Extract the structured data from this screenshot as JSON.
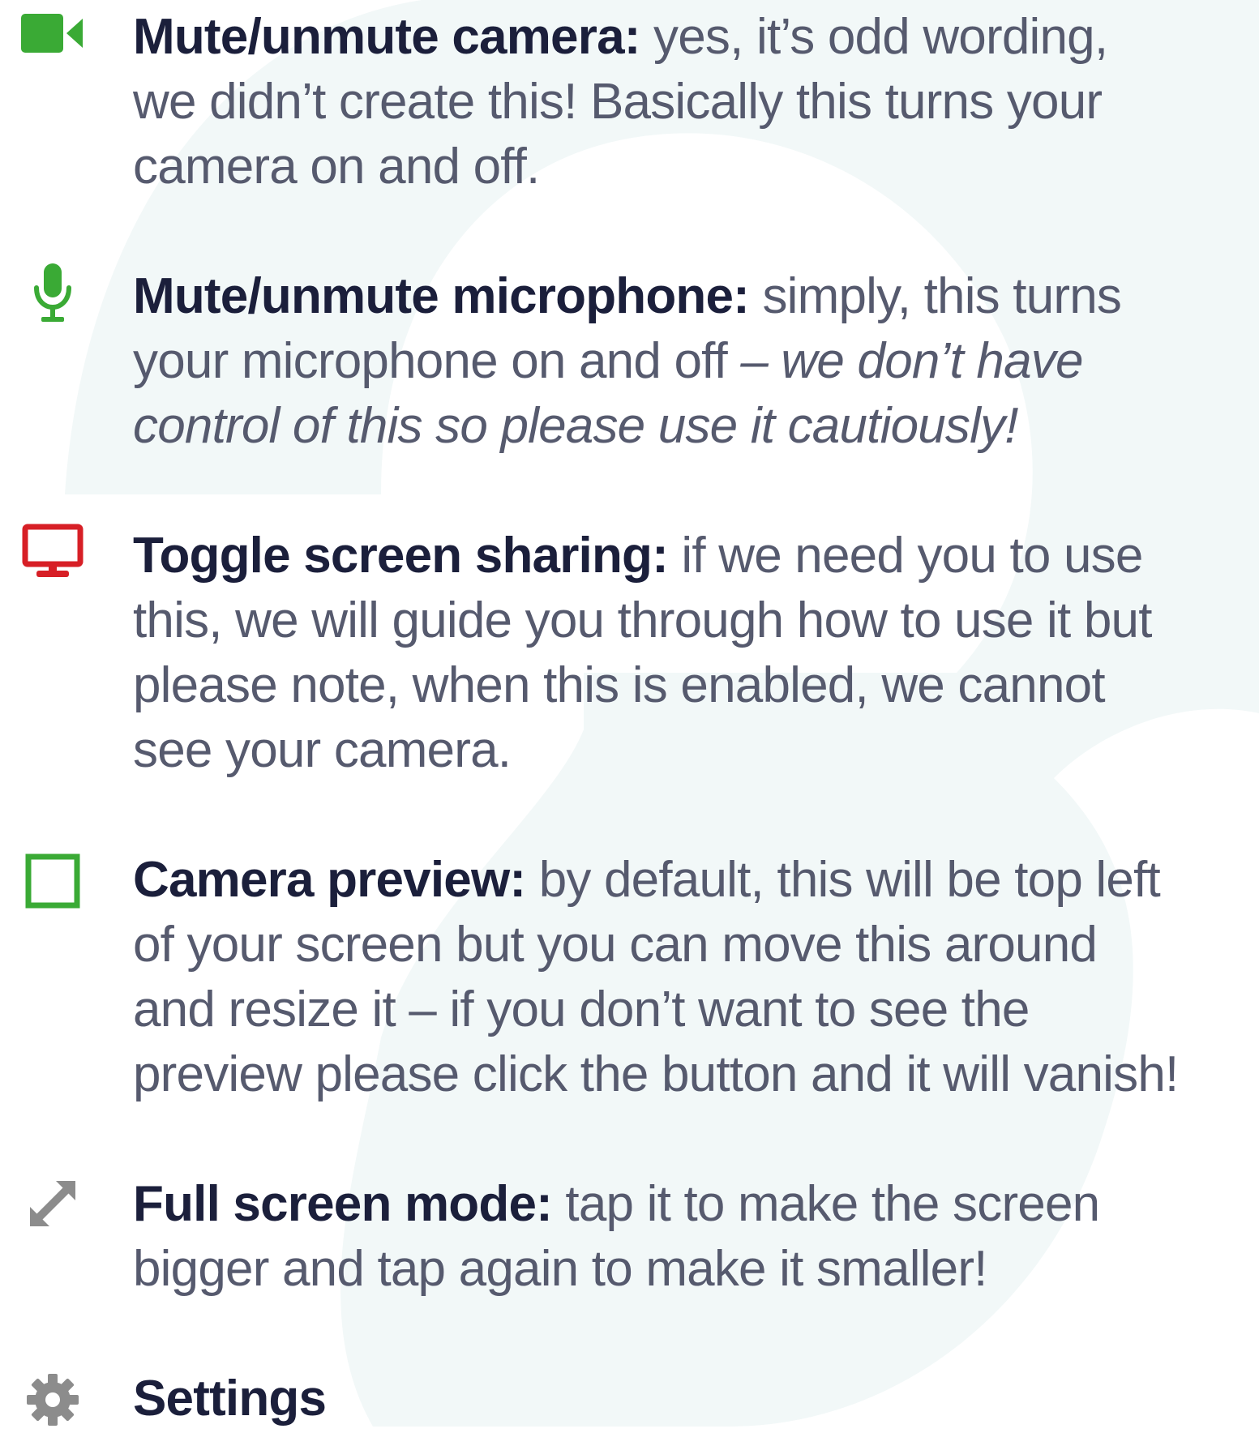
{
  "items": [
    {
      "icon": "video-camera-icon",
      "icon_color": "#3aaa35",
      "term": "Mute/unmute camera:",
      "lines": [
        "yes, it’s odd wording,",
        "we didn’t create this! Basically this turns your",
        "camera on and off."
      ]
    },
    {
      "icon": "microphone-icon",
      "icon_color": "#3aaa35",
      "term": "Mute/unmute microphone:",
      "lines": [
        "simply, this turns",
        "your microphone on and off"
      ],
      "note_lines": [
        "– we don’t have",
        "control of this so please use it cautiously!"
      ]
    },
    {
      "icon": "monitor-icon",
      "icon_color": "#d71f26",
      "term": "Toggle screen sharing:",
      "lines": [
        "if we need you to use",
        "this, we will guide you through how to use it but",
        "please note, when this is enabled, we cannot",
        "see your camera."
      ]
    },
    {
      "icon": "square-outline-icon",
      "icon_color": "#3aaa35",
      "term": "Camera preview:",
      "lines": [
        "by default, this will be top left",
        "of your screen but you can move this around",
        "and resize it – if you don’t want to see the",
        "preview please click the button and it will vanish!"
      ]
    },
    {
      "icon": "expand-arrow-icon",
      "icon_color": "#8c8c8c",
      "term": "Full screen mode:",
      "lines": [
        "tap it to make the screen",
        "bigger and tap again to make it smaller!"
      ]
    },
    {
      "icon": "gear-icon",
      "icon_color": "#8c8c8c",
      "term": "Settings"
    }
  ]
}
